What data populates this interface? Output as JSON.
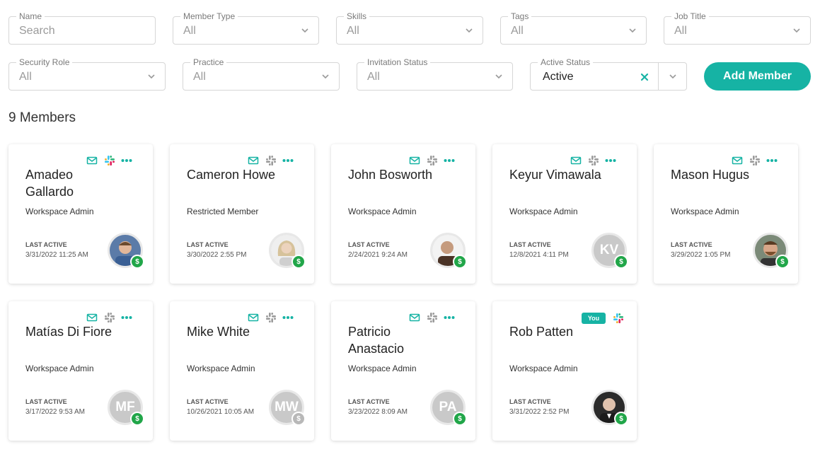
{
  "filters": {
    "name": {
      "label": "Name",
      "placeholder": "Search"
    },
    "member_type": {
      "label": "Member Type",
      "value": "All"
    },
    "skills": {
      "label": "Skills",
      "value": "All"
    },
    "tags": {
      "label": "Tags",
      "value": "All"
    },
    "job_title": {
      "label": "Job Title",
      "value": "All"
    },
    "security_role": {
      "label": "Security Role",
      "value": "All"
    },
    "practice": {
      "label": "Practice",
      "value": "All"
    },
    "invitation_status": {
      "label": "Invitation Status",
      "value": "All"
    },
    "active_status": {
      "label": "Active Status",
      "value": "Active"
    }
  },
  "add_member_label": "Add Member",
  "member_count": "9 Members",
  "last_active_label": "LAST ACTIVE",
  "you_label": "You",
  "colors": {
    "accent": "#16b3a4",
    "paid": "#21a649",
    "unpaid": "#b8b8b8"
  },
  "members": [
    {
      "name": "Amadeo Gallardo",
      "role": "Workspace Admin",
      "last_active": "3/31/2022 11:25 AM",
      "avatar": "photo",
      "paid": true
    },
    {
      "name": "Cameron Howe",
      "role": "Restricted Member",
      "last_active": "3/30/2022 2:55 PM",
      "avatar": "photo",
      "paid": true
    },
    {
      "name": "John Bosworth",
      "role": "Workspace Admin",
      "last_active": "2/24/2021 9:24 AM",
      "avatar": "photo",
      "paid": true
    },
    {
      "name": "Keyur Vimawala",
      "role": "Workspace Admin",
      "last_active": "12/8/2021 4:11 PM",
      "avatar": "KV",
      "paid": true
    },
    {
      "name": "Mason Hugus",
      "role": "Workspace Admin",
      "last_active": "3/29/2022 1:05 PM",
      "avatar": "photo",
      "paid": true
    },
    {
      "name": "Matías Di Fiore",
      "role": "Workspace Admin",
      "last_active": "3/17/2022 9:53 AM",
      "avatar": "MF",
      "paid": true
    },
    {
      "name": "Mike White",
      "role": "Workspace Admin",
      "last_active": "10/26/2021 10:05 AM",
      "avatar": "MW",
      "paid": false
    },
    {
      "name": "Patricio Anastacio",
      "role": "Workspace Admin",
      "last_active": "3/23/2022 8:09 AM",
      "avatar": "PA",
      "paid": true
    },
    {
      "name": "Rob Patten",
      "role": "Workspace Admin",
      "last_active": "3/31/2022 2:52 PM",
      "avatar": "photo",
      "paid": true,
      "is_you": true
    }
  ]
}
